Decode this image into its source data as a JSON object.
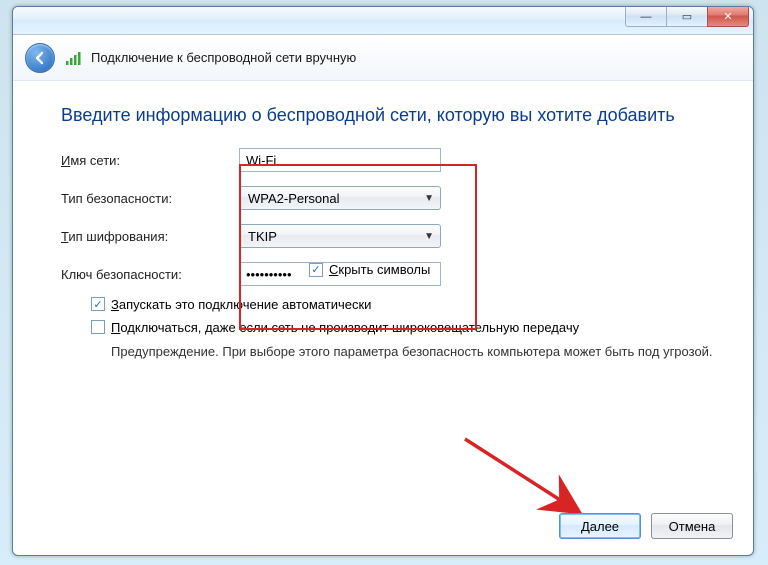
{
  "window": {
    "minimize_glyph": "—",
    "maximize_glyph": "▭",
    "close_glyph": "✕"
  },
  "header": {
    "title": "Подключение к беспроводной сети вручную"
  },
  "main": {
    "heading": "Введите информацию о беспроводной сети, которую вы хотите добавить",
    "labels": {
      "network_name_pre": "И",
      "network_name": "мя сети:",
      "security_type": "Тип безопасности:",
      "encryption_type_pre": "Т",
      "encryption_type": "ип шифрования:",
      "security_key": "Ключ безопасности:",
      "hide_chars_pre": "С",
      "hide_chars": "крыть символы",
      "auto_start_pre": "З",
      "auto_start": "апускать это подключение автоматически",
      "connect_hidden_pre": "П",
      "connect_hidden": "одключаться, даже если сеть не производит широковещательную передачу",
      "warning": "Предупреждение. При выборе этого параметра безопасность компьютера может быть под угрозой."
    },
    "values": {
      "network_name": "Wi-Fi",
      "security_type": "WPA2-Personal",
      "encryption_type": "TKIP",
      "security_key": "••••••••••",
      "hide_chars_checked": "✓",
      "auto_start_checked": "✓",
      "connect_hidden_checked": ""
    }
  },
  "footer": {
    "next": "Далее",
    "cancel": "Отмена"
  }
}
